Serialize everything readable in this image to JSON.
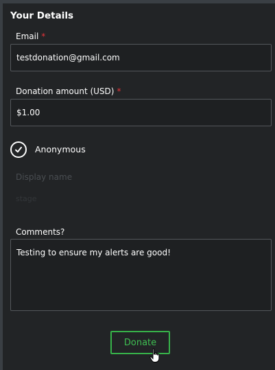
{
  "section": {
    "title": "Your Details"
  },
  "email": {
    "label": "Email",
    "required_mark": "*",
    "value": "testdonation@gmail.com"
  },
  "amount": {
    "label": "Donation amount (USD)",
    "required_mark": "*",
    "value": "$1.00"
  },
  "anonymous": {
    "label": "Anonymous",
    "checked": true
  },
  "display_name": {
    "label": "Display name",
    "placeholder": "stage"
  },
  "comments": {
    "label": "Comments?",
    "value": "Testing to ensure my alerts are good!"
  },
  "donate_button": {
    "label": "Donate"
  },
  "colors": {
    "accent": "#37b34a",
    "required": "#e8343a",
    "panel": "#222426",
    "field_border": "#54585c"
  },
  "icons": {
    "checkbox": "check-icon",
    "cursor": "hand-pointer-icon"
  }
}
